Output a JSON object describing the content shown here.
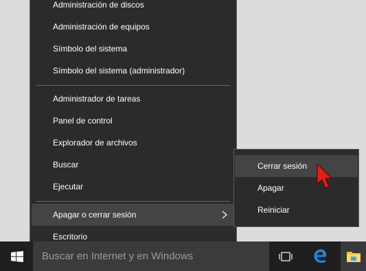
{
  "menu": {
    "groups": [
      [
        "Administración de discos",
        "Administración de equipos",
        "Símbolo del sistema",
        "Símbolo del sistema (administrador)"
      ],
      [
        "Administrador de tareas",
        "Panel de control",
        "Explorador de archivos",
        "Buscar",
        "Ejecutar"
      ],
      [
        "Apagar o cerrar sesión",
        "Escritorio"
      ]
    ]
  },
  "submenu": {
    "items": [
      "Cerrar sesión",
      "Apagar",
      "Reiniciar"
    ]
  },
  "taskbar": {
    "search_placeholder": "Buscar en Internet y en Windows"
  },
  "icons": {
    "start": "windows-logo-icon",
    "chevron": "chevron-right-icon",
    "task_view": "task-view-icon",
    "edge": "edge-icon",
    "explorer": "file-explorer-icon",
    "cursor": "mouse-pointer-icon"
  },
  "colors": {
    "menu_bg": "#2b2b2b",
    "highlight": "#444444",
    "taskbar_bg": "#1f1f1f",
    "accent": "#1e88e5",
    "cursor": "#e0201a"
  }
}
